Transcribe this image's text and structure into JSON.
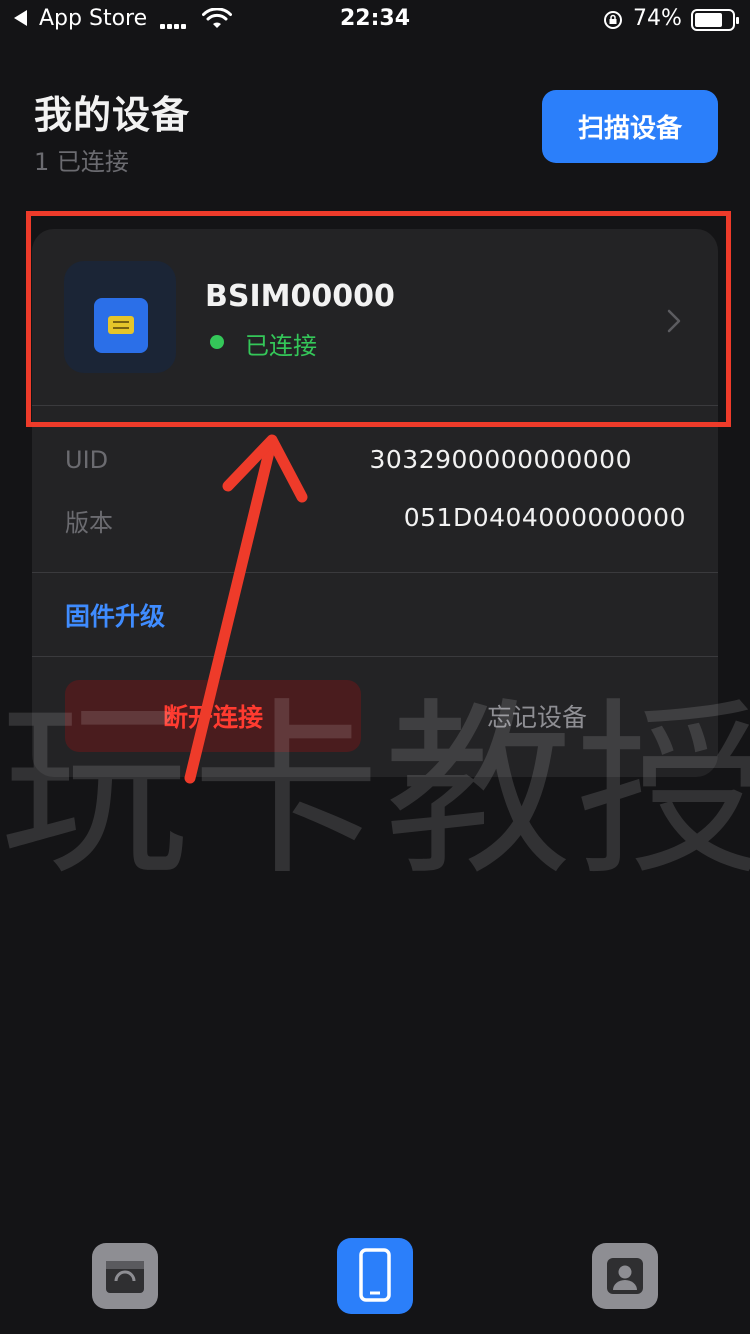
{
  "status_bar": {
    "app_name": "App Store",
    "time": "22:34",
    "battery_percent": "74%",
    "battery_level": 0.74
  },
  "header": {
    "title": "我的设备",
    "subtitle": "1 已连接",
    "scan_button_label": "扫描设备"
  },
  "device": {
    "name": "BSIM00000",
    "status": "已连接",
    "status_color": "#34c759",
    "info": [
      {
        "label": "UID",
        "value": "3032900000000000"
      },
      {
        "label": "版本",
        "value": "051D0404000000000"
      }
    ],
    "firmware_link": "固件升级",
    "disconnect_label": "断开连接",
    "forget_label": "忘记设备"
  },
  "watermark": "玩卡教授",
  "tab_bar": {
    "tabs": [
      {
        "name": "shop",
        "icon": "shop-icon",
        "active": false
      },
      {
        "name": "devices",
        "icon": "phone-icon",
        "active": true
      },
      {
        "name": "profile",
        "icon": "person-icon",
        "active": false
      }
    ]
  },
  "colors": {
    "background": "#141416",
    "card": "#232325",
    "accent": "#2b7ffa",
    "danger": "#ff3b30",
    "annotation": "#ee3b2a"
  }
}
